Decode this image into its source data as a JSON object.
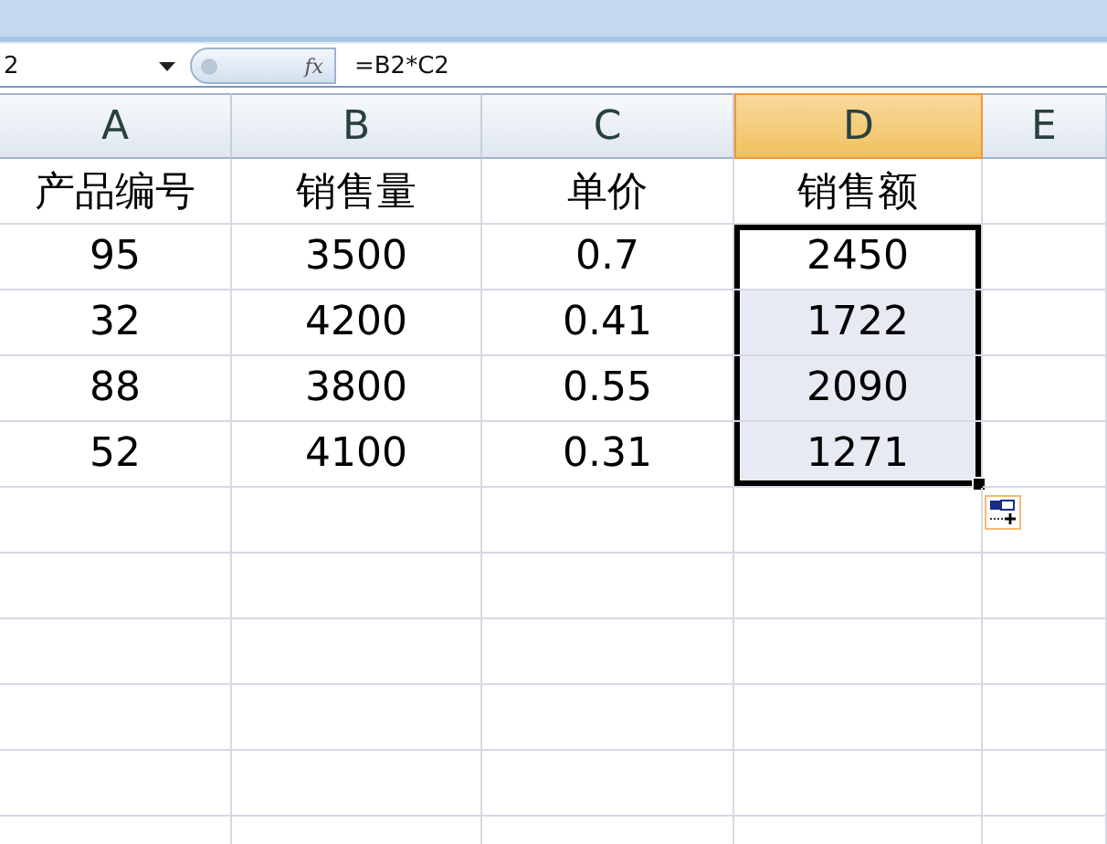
{
  "formula_bar": {
    "name_box": "2",
    "fx_label": "fx",
    "formula": "=B2*C2"
  },
  "columns": [
    {
      "label": "A",
      "selected": false
    },
    {
      "label": "B",
      "selected": false
    },
    {
      "label": "C",
      "selected": false
    },
    {
      "label": "D",
      "selected": true
    },
    {
      "label": "E",
      "selected": false
    }
  ],
  "rows": [
    {
      "cells": [
        {
          "text": "产品编号",
          "selected": false
        },
        {
          "text": "销售量",
          "selected": false
        },
        {
          "text": "单价",
          "selected": false
        },
        {
          "text": "销售额",
          "selected": false
        }
      ]
    },
    {
      "cells": [
        {
          "text": "95",
          "selected": false
        },
        {
          "text": "3500",
          "selected": false
        },
        {
          "text": "0.7",
          "selected": false
        },
        {
          "text": "2450",
          "selected": true,
          "active": true
        }
      ]
    },
    {
      "cells": [
        {
          "text": "32",
          "selected": false
        },
        {
          "text": "4200",
          "selected": false
        },
        {
          "text": "0.41",
          "selected": false
        },
        {
          "text": "1722",
          "selected": true,
          "active": false
        }
      ]
    },
    {
      "cells": [
        {
          "text": "88",
          "selected": false
        },
        {
          "text": "3800",
          "selected": false
        },
        {
          "text": "0.55",
          "selected": false
        },
        {
          "text": "2090",
          "selected": true,
          "active": false
        }
      ]
    },
    {
      "cells": [
        {
          "text": "52",
          "selected": false
        },
        {
          "text": "4100",
          "selected": false
        },
        {
          "text": "0.31",
          "selected": false
        },
        {
          "text": "1271",
          "selected": true,
          "active": false
        }
      ]
    }
  ]
}
